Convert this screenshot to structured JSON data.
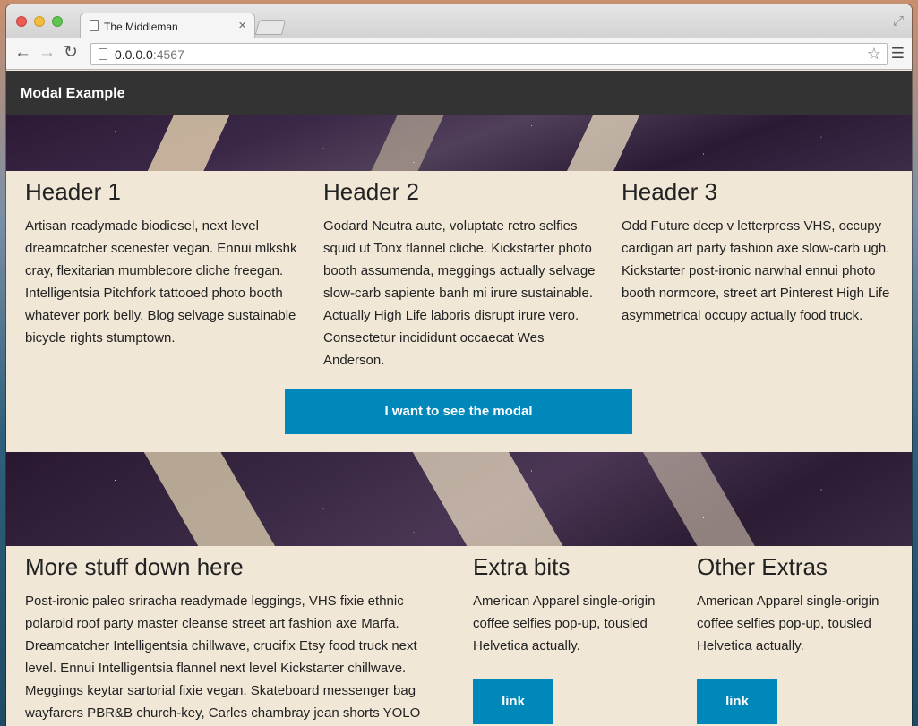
{
  "browser": {
    "tab_title": "The Middleman",
    "tab_close": "×",
    "url_host": "0.0.0.0",
    "url_port": ":4567"
  },
  "navbar": {
    "brand": "Modal Example"
  },
  "section1": {
    "columns": [
      {
        "heading": "Header 1",
        "body": "Artisan readymade biodiesel, next level dreamcatcher scenester vegan. Ennui mlkshk cray, flexitarian mumblecore cliche freegan. Intelligentsia Pitchfork tattooed photo booth whatever pork belly. Blog selvage sustainable bicycle rights stumptown."
      },
      {
        "heading": "Header 2",
        "body": "Godard Neutra aute, voluptate retro selfies squid ut Tonx flannel cliche. Kickstarter photo booth assumenda, meggings actually selvage slow-carb sapiente banh mi irure sustainable. Actually High Life laboris disrupt irure vero. Consectetur incididunt occaecat Wes Anderson."
      },
      {
        "heading": "Header 3",
        "body": "Odd Future deep v letterpress VHS, occupy cardigan art party fashion axe slow-carb ugh. Kickstarter post-ironic narwhal ennui photo booth normcore, street art Pinterest High Life asymmetrical occupy actually food truck."
      }
    ],
    "cta_label": "I want to see the modal"
  },
  "section2": {
    "main": {
      "heading": "More stuff down here",
      "body": "Post-ironic paleo sriracha readymade leggings, VHS fixie ethnic polaroid roof party master cleanse street art fashion axe Marfa. Dreamcatcher Intelligentsia chillwave, crucifix Etsy food truck next level. Ennui Intelligentsia flannel next level Kickstarter chillwave. Meggings keytar sartorial fixie vegan. Skateboard messenger bag wayfarers PBR&B church-key, Carles chambray jean shorts YOLO"
    },
    "extra": {
      "heading": "Extra bits",
      "body": "American Apparel single-origin coffee selfies pop-up, tousled Helvetica actually.",
      "link_label": "link"
    },
    "other": {
      "heading": "Other Extras",
      "body": "American Apparel single-origin coffee selfies pop-up, tousled Helvetica actually.",
      "link_label": "link"
    }
  },
  "colors": {
    "navbar": "#333333",
    "accent": "#0088bb",
    "page_bg": "#f0e7d6"
  }
}
